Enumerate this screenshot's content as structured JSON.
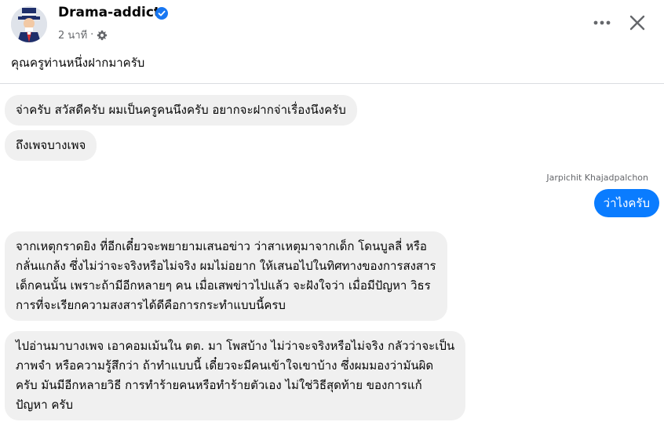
{
  "post": {
    "author": "Drama-addict",
    "time": "2 นาที",
    "separator": "·",
    "caption": "คุณครูท่านหนึ่งฝากมาครับ",
    "icons": {
      "verified": "verified-badge-icon",
      "audience": "gear-icon",
      "more": "more-options-icon",
      "close": "close-icon"
    },
    "colors": {
      "verified": "#1877f2",
      "outgoing_bubble": "#0a7cff",
      "incoming_bubble": "#f0f0f0"
    }
  },
  "chat": {
    "incoming_1": "จ่าครับ สวัสดีครับ ผมเป็นครูคนนึงครับ อยากจะฝากจ่าเรื่องนึงครับ",
    "incoming_2": "ถึงเพจบางเพจ",
    "reply_sender": "Jarpichit Khajadpalchon",
    "reply": "ว่าไงครับ",
    "incoming_3": [
      "จากเหตุกราดยิง ที่อีกเดี๋ยวจะพยายามเสนอข่าว ว่าสาเหตุมาจากเด็ก โดนบูลลี่ หรือ",
      "กลั่นแกล้ง ซึ่งไม่ว่าจะจริงหรือไม่จริง ผมไม่อยาก ให้เสนอไปในทิศทางของการสงสาร",
      "เด็กคนนั้น เพราะถ้ามีอีกหลายๆ คน เมื่อเสพข่าวไปแล้ว จะฝังใจว่า เมื่อมีปัญหา วิธร",
      "การที่จะเรียกความสงสารได้ดีคือการกระทำแบบนี้ครบ"
    ],
    "incoming_4": [
      "ไปอ่านมาบางเพจ เอาคอมเม้นใน ตต. มา โพสบ้าง ไม่ว่าจะจริงหรือไม่จริง กลัวว่าจะเป็น",
      "ภาพจำ หรือความรู้สึกว่า ถ้าทำแบบนี้ เดี๋ยวจะมีคนเข้าใจเขาบ้าง ซึ่งผมมองว่ามันผิด",
      "ครับ มันมีอีกหลายวิธี การทำร้ายคนหรือทำร้ายตัวเอง ไม่ใช่วิธีสุดท้าย ของการแก้",
      "ปัญหา ครับ"
    ]
  }
}
